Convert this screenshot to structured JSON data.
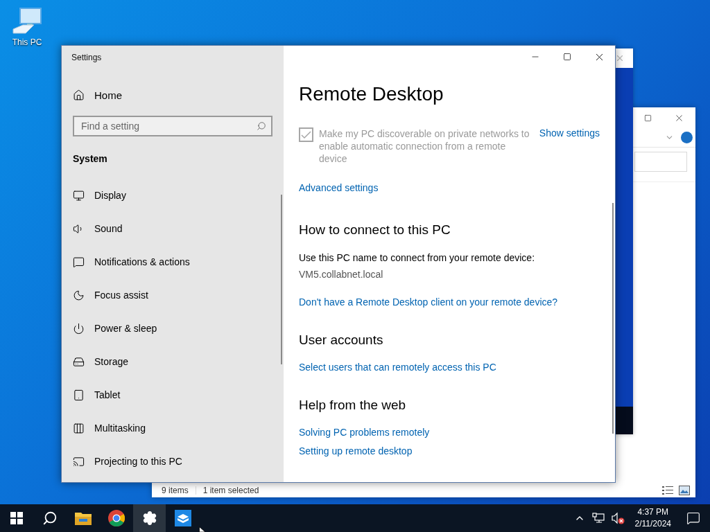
{
  "desktop_icons": [
    {
      "label": "This PC"
    }
  ],
  "explorer_window": {
    "status_items": [
      "9 items",
      "1 item selected"
    ]
  },
  "settings_window": {
    "title": "Settings",
    "sidebar": {
      "home": "Home",
      "search": {
        "placeholder": "Find a setting"
      },
      "section": "System",
      "items": [
        {
          "label": "Display"
        },
        {
          "label": "Sound"
        },
        {
          "label": "Notifications & actions"
        },
        {
          "label": "Focus assist"
        },
        {
          "label": "Power & sleep"
        },
        {
          "label": "Storage"
        },
        {
          "label": "Tablet"
        },
        {
          "label": "Multitasking"
        },
        {
          "label": "Projecting to this PC"
        }
      ]
    },
    "page": {
      "title": "Remote Desktop",
      "checkbox": {
        "label": "Make my PC discoverable on private networks to enable automatic connection from a remote device",
        "checked": true,
        "disabled": true
      },
      "side_link": "Show settings",
      "advanced_link": "Advanced settings",
      "sections": [
        {
          "title": "How to connect to this PC",
          "items": [
            {
              "kind": "text",
              "text": "Use this PC name to connect from your remote device:"
            },
            {
              "kind": "value",
              "text": "VM5.collabnet.local"
            },
            {
              "kind": "link",
              "text": "Don't have a Remote Desktop client on your remote device?"
            }
          ]
        },
        {
          "title": "User accounts",
          "items": [
            {
              "kind": "link",
              "text": "Select users that can remotely access this PC"
            }
          ]
        },
        {
          "title": "Help from the web",
          "items": [
            {
              "kind": "link",
              "text": "Solving PC problems remotely"
            },
            {
              "kind": "link",
              "text": "Setting up remote desktop"
            }
          ]
        }
      ]
    }
  },
  "taskbar": {
    "apps": [
      {
        "kind": "start",
        "active": false
      },
      {
        "kind": "search",
        "active": false
      },
      {
        "kind": "explorer",
        "active": false
      },
      {
        "kind": "chrome",
        "active": false
      },
      {
        "kind": "settings",
        "active": true
      },
      {
        "kind": "app",
        "active": false
      }
    ],
    "clock": {
      "time": "4:37 PM",
      "date": "2/11/2024"
    }
  }
}
